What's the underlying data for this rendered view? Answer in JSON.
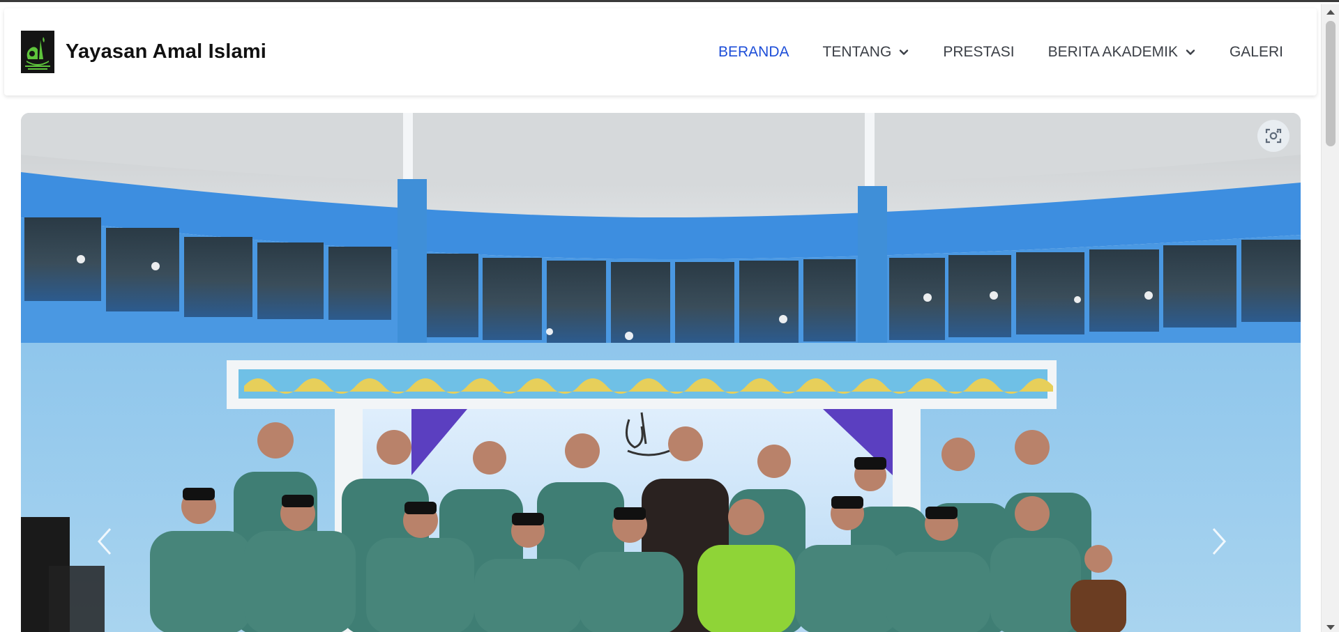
{
  "brand": {
    "name": "Yayasan Amal Islami",
    "logo_icon": "yai-logo-icon"
  },
  "nav": {
    "items": [
      {
        "label": "BERANDA",
        "active": true,
        "dropdown": false
      },
      {
        "label": "TENTANG",
        "active": false,
        "dropdown": true
      },
      {
        "label": "PRESTASI",
        "active": false,
        "dropdown": false
      },
      {
        "label": "BERITA AKADEMIK",
        "active": false,
        "dropdown": true
      },
      {
        "label": "GALERI",
        "active": false,
        "dropdown": false
      }
    ]
  },
  "hero": {
    "image_icon": "group-photo-image",
    "lens_icon": "visual-search-icon",
    "prev_icon": "chevron-left-icon",
    "next_icon": "chevron-right-icon"
  },
  "colors": {
    "active_nav": "#1d4ed8",
    "nav_text": "#3b3f46",
    "brand_text": "#111111",
    "wall_blue": "#3d8ee0",
    "logo_green": "#5ec43c"
  }
}
